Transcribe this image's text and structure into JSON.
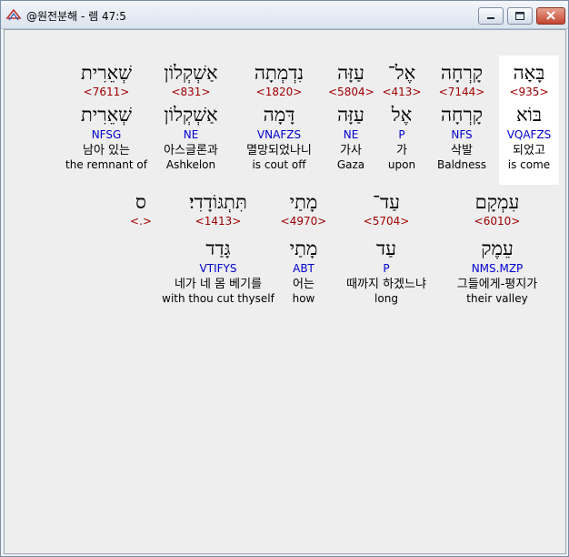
{
  "window": {
    "title": "@원전분해 - 렘 47:5"
  },
  "words": [
    {
      "hebrew": "בָּאָה",
      "strongs": "<935>",
      "lemma": "בּוֹא",
      "morph": "VQAFZS",
      "korean": "되었고",
      "english": "is come"
    },
    {
      "hebrew": "קָרְחָה",
      "strongs": "<7144>",
      "lemma": "קָרְחָה",
      "morph": "NFS",
      "korean": "삭발",
      "english": "Baldness"
    },
    {
      "hebrew": "אֶל־",
      "strongs": "<413>",
      "lemma": "אֶל",
      "morph": "P",
      "korean": "가",
      "english": "upon"
    },
    {
      "hebrew": "עַזָּה",
      "strongs": "<5804>",
      "lemma": "עַזָּה",
      "morph": "NE",
      "korean": "가사",
      "english": "Gaza"
    },
    {
      "hebrew": "נִדְמְתָה",
      "strongs": "<1820>",
      "lemma": "דָּמָה",
      "morph": "VNAFZS",
      "korean": "멸망되었나니",
      "english": "is cout off"
    },
    {
      "hebrew": "אַשְׁקְלוֹן",
      "strongs": "<831>",
      "lemma": "אַשְׁקְלוֹן",
      "morph": "NE",
      "korean": "아스글론과",
      "english": "Ashkelon"
    },
    {
      "hebrew": "שְׁאֵרִית",
      "strongs": "<7611>",
      "lemma": "שְׁאֵרִית",
      "morph": "NFSG",
      "korean": "남아 있는",
      "english": "the remnant of"
    },
    {
      "hebrew": "עִמְקָם",
      "strongs": "<6010>",
      "lemma": "עֵמֶק",
      "morph": "NMS.MZP",
      "korean": "그들에게-평지가",
      "english": "their valley"
    },
    {
      "hebrew": "עַד־",
      "strongs": "<5704>",
      "lemma": "עַד",
      "morph": "P",
      "korean": "때까지 하겠느냐",
      "english": "long"
    },
    {
      "hebrew": "מָתַי",
      "strongs": "<4970>",
      "lemma": "מָתַי",
      "morph": "ABT",
      "korean": "어는",
      "english": "how"
    },
    {
      "hebrew": "תִּתְגּוֹדָדִי׃",
      "strongs": "<1413>",
      "lemma": "גָּדַד",
      "morph": "VTIFYS",
      "korean": "네가 네 몸 베기를",
      "english": "with thou cut thyself"
    },
    {
      "hebrew": "ס",
      "strongs": "<.>",
      "lemma": "",
      "morph": "",
      "korean": "",
      "english": ""
    }
  ]
}
